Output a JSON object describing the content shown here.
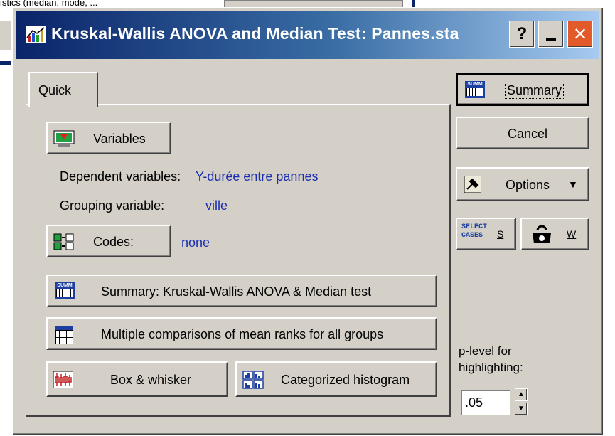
{
  "background": {
    "top_text": "istics (median, mode, ..."
  },
  "window": {
    "title": "Kruskal-Wallis ANOVA and Median Test: Pannes.sta",
    "help_label": "?",
    "minimize_label": "_",
    "close_label": "✕"
  },
  "tabs": [
    {
      "label": "Quick"
    }
  ],
  "quick": {
    "variables_label": "Variables",
    "dependent_label": "Dependent variables:",
    "dependent_value": "Y-durée entre pannes",
    "grouping_label": "Grouping variable:",
    "grouping_value": "ville",
    "codes_label": "Codes:",
    "codes_value": "none",
    "summary_label": "Summary:  Kruskal-Wallis ANOVA  & Median test",
    "multiple_label": "Multiple comparisons of mean ranks for all groups",
    "boxwhisker_label": "Box & whisker",
    "histogram_label": "Categorized histogram"
  },
  "side": {
    "summary_label": "Summary",
    "cancel_label": "Cancel",
    "options_label": "Options",
    "select_cases_icon_text": "SELECT\nCASES",
    "select_s_label": "S",
    "weight_w_label": "W",
    "plevel_label_1": "p-level for",
    "plevel_label_2": "highlighting:",
    "plevel_value": ".05"
  },
  "icons": {
    "summary_icon_text": "SUMM",
    "colors": {
      "titlebar_start": "#0a246a",
      "titlebar_end": "#a6caf0",
      "link_blue": "#1c2fb0",
      "close_red": "#e35a2a"
    }
  }
}
